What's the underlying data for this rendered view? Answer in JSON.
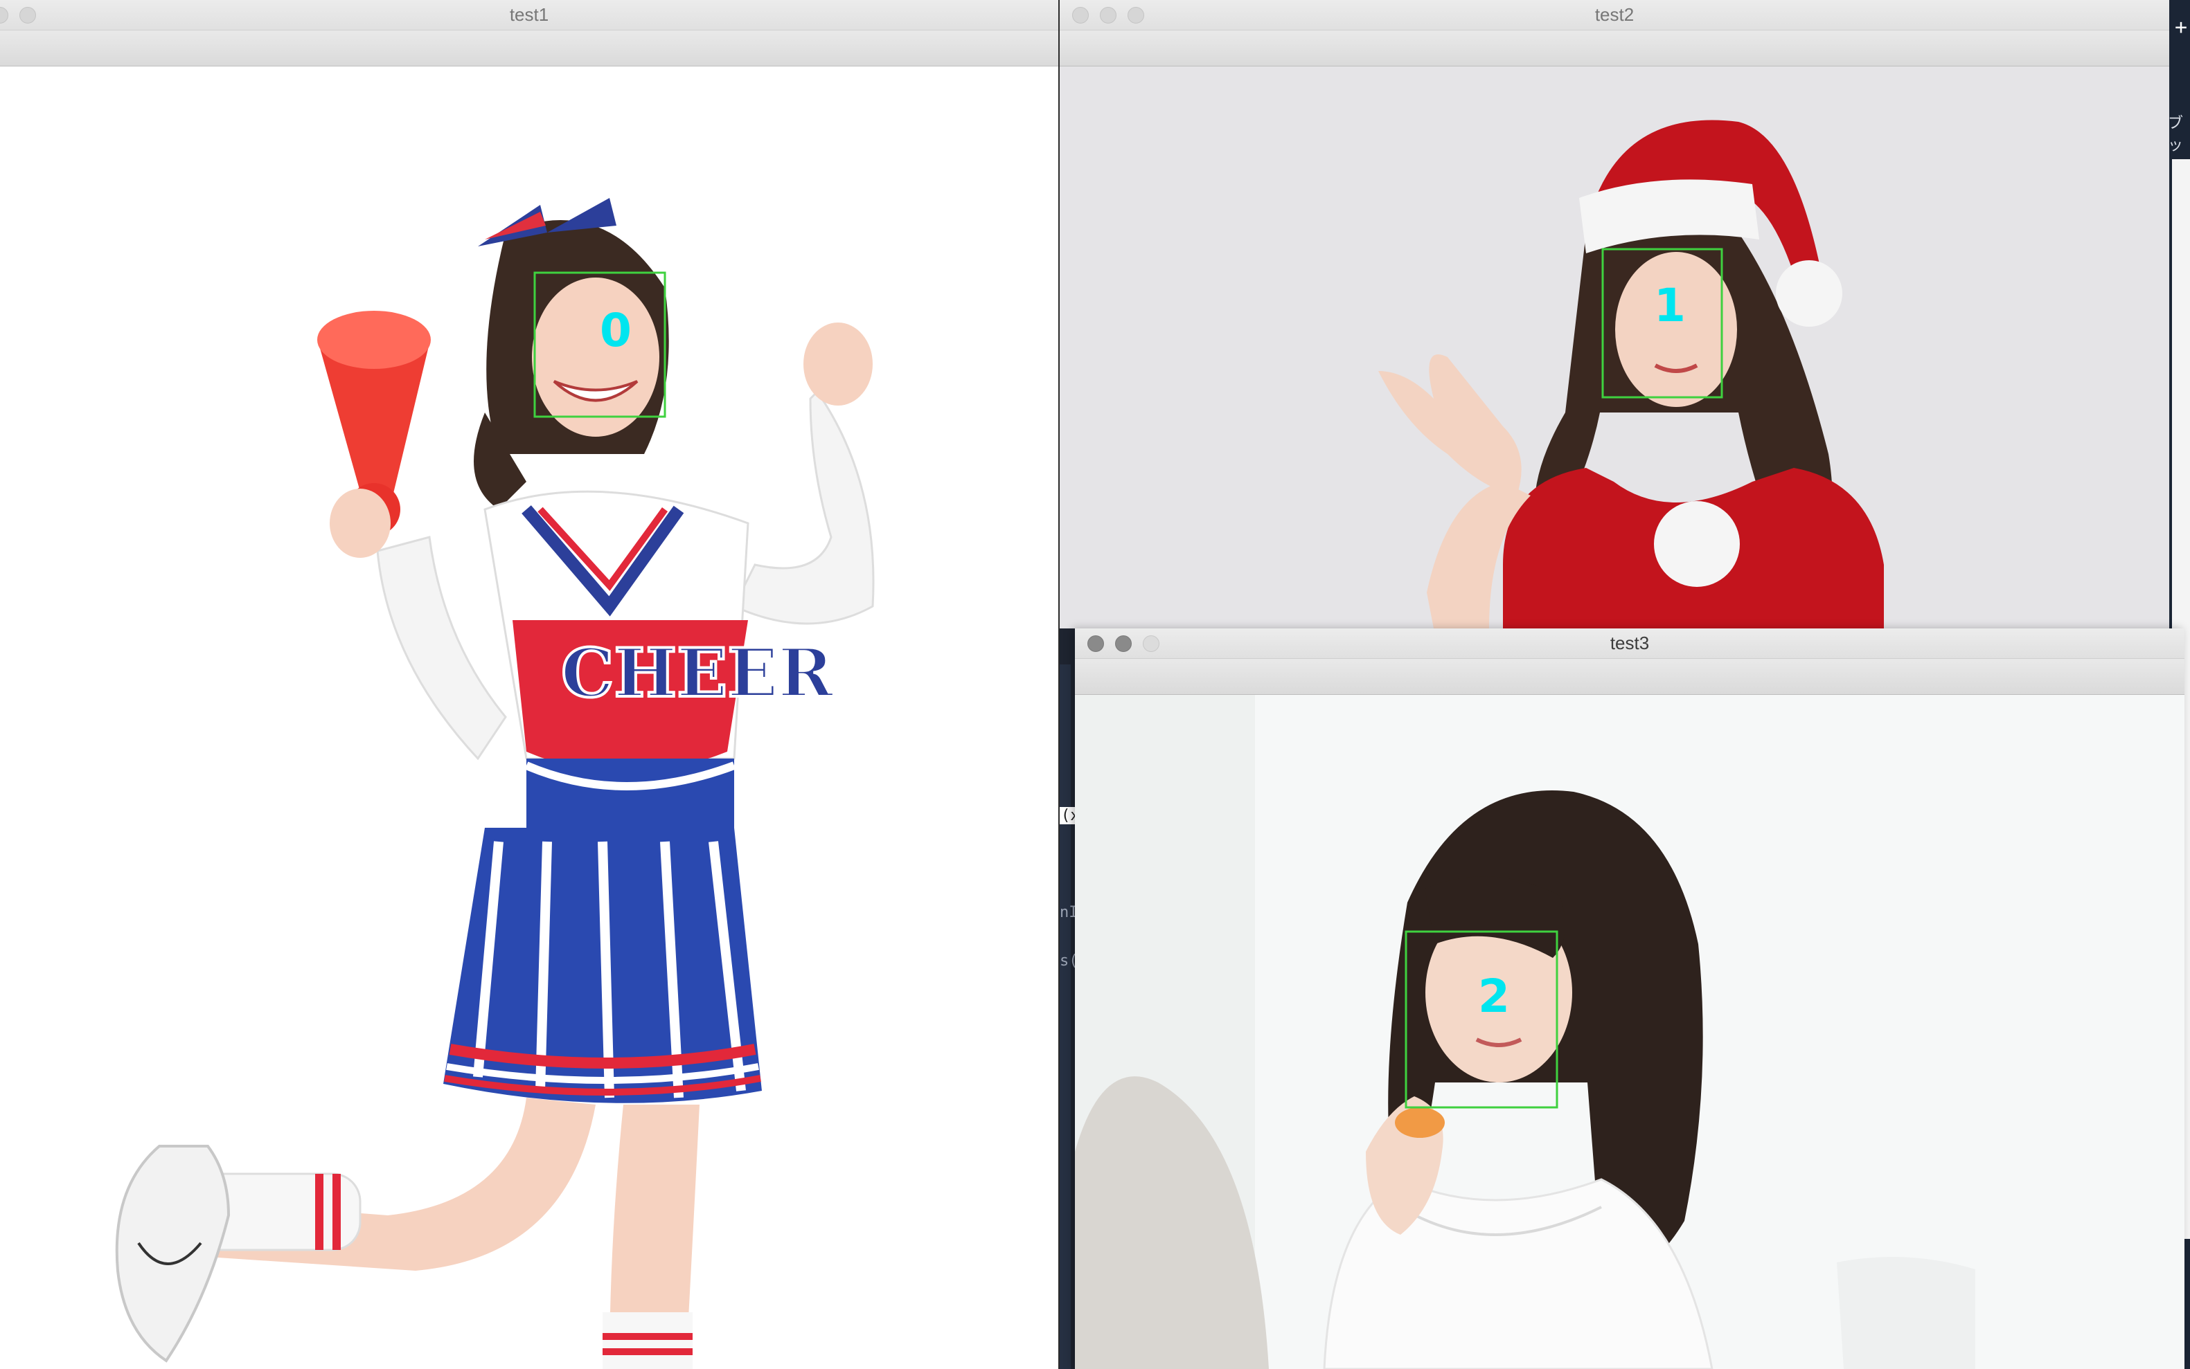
{
  "windows": [
    {
      "id": "test1",
      "title": "test1",
      "face_label": "0"
    },
    {
      "id": "test2",
      "title": "test2",
      "face_label": "1"
    },
    {
      "id": "test3",
      "title": "test3",
      "face_label": "2"
    }
  ],
  "background_fragments": {
    "right_edge_text": "ブッ",
    "right_edge_symbol": "+",
    "code_fragment_1": "(x",
    "code_fragment_2": "nI",
    "code_fragment_3": "s("
  },
  "colors": {
    "face_box": "#3fd13f",
    "face_label": "#00e5ef"
  }
}
